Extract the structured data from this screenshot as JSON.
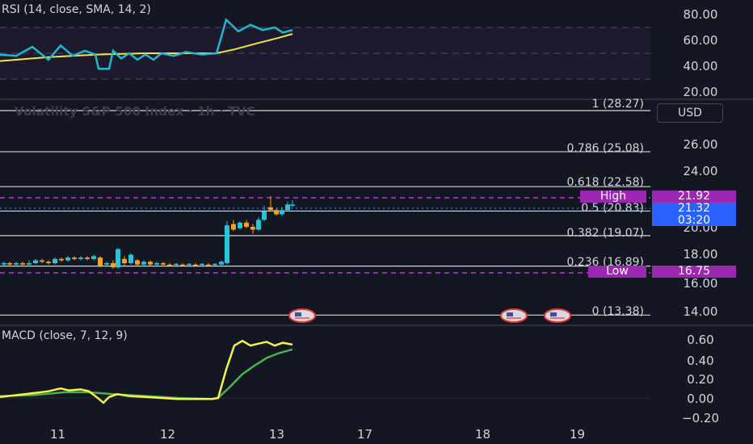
{
  "colors": {
    "background": "#131722",
    "rsi_line": "#1fb8d0",
    "rsi_sma": "#f2e34c",
    "rsi_band": "#1c1a2c",
    "macd_line": "#f7f34a",
    "signal_line": "#4caf50",
    "fib_line": "#d1d4dc",
    "high_low_dashed": "#9c27b0",
    "up_candle": "#26c6da",
    "down_candle": "#f7a21b",
    "current_price_tag": "#2962ff",
    "high_low_tag": "#9c27b0"
  },
  "rsi": {
    "title": "RSI (14, close, SMA, 14, 2)",
    "ticks": [
      "80.00",
      "60.00",
      "40.00",
      "20.00"
    ]
  },
  "main": {
    "title": "Volatility S&P 500 Index · 1h · TVC",
    "currency": "USD",
    "ticks": [
      "26.00",
      "24.00",
      "22.00",
      "20.00",
      "18.00",
      "16.00",
      "14.00"
    ],
    "fib_levels": [
      {
        "label": "1 (28.27)",
        "value": 28.27
      },
      {
        "label": "0.786 (25.08)",
        "value": 25.08
      },
      {
        "label": "0.618 (22.58)",
        "value": 22.58
      },
      {
        "label": "0.5 (20.83)",
        "value": 20.83
      },
      {
        "label": "0.382 (19.07)",
        "value": 19.07
      },
      {
        "label": "0.236 (16.89)",
        "value": 16.89
      },
      {
        "label": "0 (13.38)",
        "value": 13.38
      }
    ],
    "high": {
      "label": "High",
      "value": "21.92"
    },
    "low": {
      "label": "Low",
      "value": "16.75"
    },
    "current": {
      "price": "21.32",
      "countdown": "03:20"
    },
    "event_icon": "us-flag-icon"
  },
  "macd": {
    "title": "MACD (close, 7, 12, 9)",
    "ticks": [
      "0.60",
      "0.40",
      "0.20",
      "0.00",
      "−0.20"
    ]
  },
  "x_axis": {
    "ticks": [
      "11",
      "12",
      "13",
      "17",
      "18",
      "19"
    ]
  }
}
